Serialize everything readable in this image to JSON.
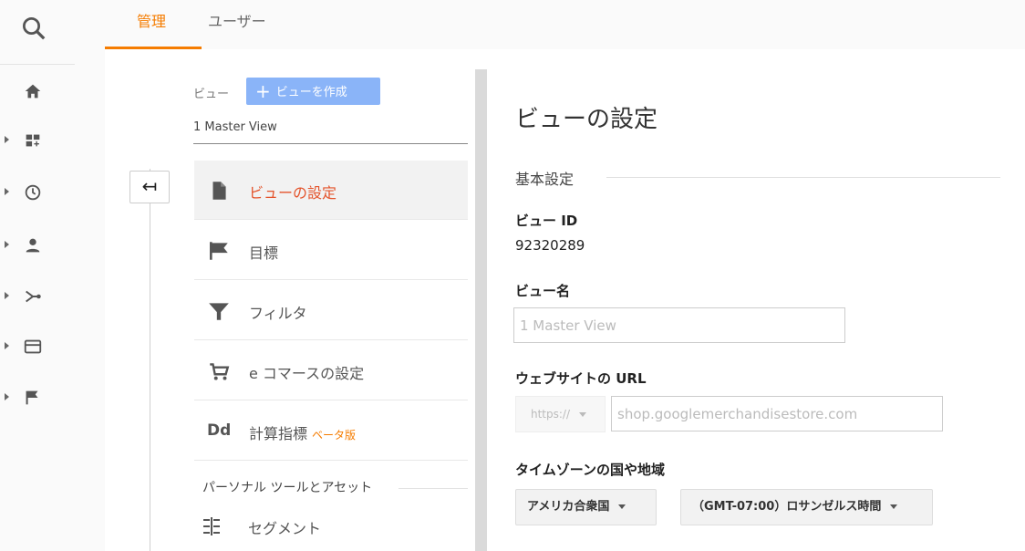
{
  "tabs": {
    "manage": "管理",
    "user": "ユーザー"
  },
  "view_column": {
    "view_label": "ビュー",
    "create_view_button": "ビューを作成",
    "selected_view": "1 Master View"
  },
  "menu": {
    "items": [
      {
        "label": "ビューの設定",
        "icon": "document-icon",
        "active": true
      },
      {
        "label": "目標",
        "icon": "flag-icon"
      },
      {
        "label": "フィルタ",
        "icon": "filter-icon"
      },
      {
        "label": "e コマースの設定",
        "icon": "cart-icon"
      },
      {
        "label": "計算指標",
        "icon": "dd-icon",
        "badge": "ベータ版"
      }
    ],
    "section_personal": "パーソナル ツールとアセット",
    "segment": "セグメント"
  },
  "panel": {
    "title": "ビューの設定",
    "basic_settings": "基本設定",
    "view_id_label": "ビュー ID",
    "view_id_value": "92320289",
    "view_name_label": "ビュー名",
    "view_name_placeholder": "1 Master View",
    "website_url_label": "ウェブサイトの URL",
    "protocol": "https://",
    "url_placeholder": "shop.googlemerchandisestore.com",
    "timezone_label": "タイムゾーンの国や地域",
    "country": "アメリカ合衆国",
    "timezone": "（GMT-07:00）ロサンゼルス時間"
  },
  "colors": {
    "accent": "#f57c00",
    "active_text": "#e4542c",
    "create_button": "#8ab4f8"
  }
}
